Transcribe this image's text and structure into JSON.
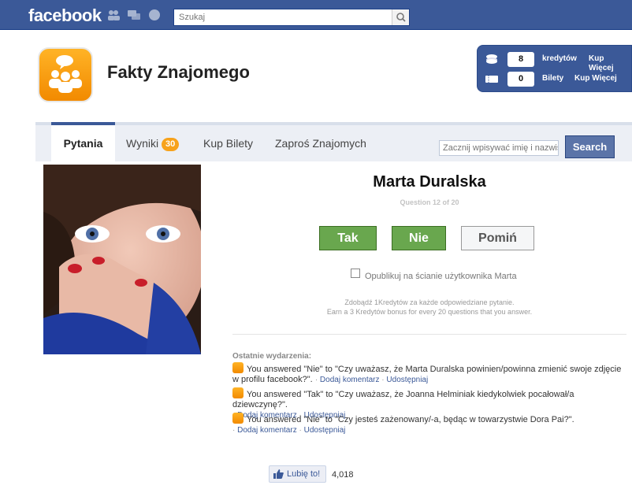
{
  "topbar": {
    "logo": "facebook",
    "search_placeholder": "Szukaj"
  },
  "app": {
    "title": "Fakty Znajomego"
  },
  "credits": {
    "credits_count": "8",
    "credits_label": "kredytów",
    "credits_buy": "Kup Więcej",
    "tickets_count": "0",
    "tickets_label": "Bilety",
    "tickets_buy": "Kup Więcej"
  },
  "tabs": [
    {
      "label": "Pytania",
      "active": true
    },
    {
      "label": "Wyniki",
      "badge": "30"
    },
    {
      "label": "Kup Bilety"
    },
    {
      "label": "Zaproś Znajomych"
    }
  ],
  "friend_search": {
    "placeholder": "Zacznij wpisywać imię i nazwisko",
    "button": "Search"
  },
  "question": {
    "person_name": "Marta Duralska",
    "progress": "Question 12 of 20",
    "answer_yes": "Tak",
    "answer_no": "Nie",
    "answer_skip": "Pomiń",
    "publish_label": "Opublikuj na ścianie użytkownika Marta",
    "earn_line1": "Zdobądź 1Kredytów za każde odpowiedziane pytanie.",
    "earn_line2": "Earn a 3 Kredytów bonus for every 20 questions that you answer."
  },
  "events": {
    "title": "Ostatnie wydarzenia:",
    "comment_label": "Dodaj komentarz",
    "share_label": "Udostępniaj",
    "items": [
      {
        "text": "You answered \"Nie\" to \"Czy uważasz, że Marta Duralska powinien/powinna zmienić swoje zdjęcie w profilu facebook?\"."
      },
      {
        "text": "You answered \"Tak\" to \"Czy uważasz, że Joanna Helminiak kiedykolwiek pocałował/a dziewczynę?\"."
      },
      {
        "text": "You answered \"Nie\" to \"Czy jesteś zażenowany/-a, będąc w towarzystwie Dora Pai?\"."
      }
    ]
  },
  "like": {
    "label": "Lubię to!",
    "count": "4,018"
  },
  "colors": {
    "facebook_blue": "#3b5998",
    "answer_green": "#69a74e",
    "accent_orange": "#f7a21b"
  }
}
